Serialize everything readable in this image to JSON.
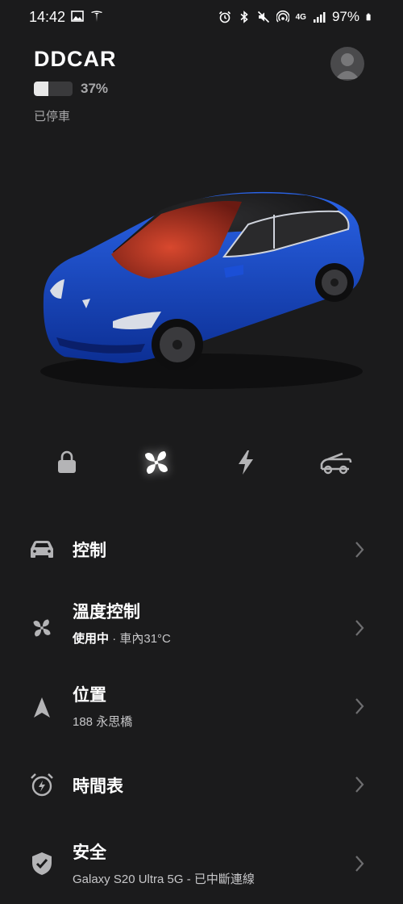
{
  "status_bar": {
    "time": "14:42",
    "battery_percent": "97%",
    "network": "4G",
    "icons": [
      "image-icon",
      "tesla-logo-icon",
      "alarm-icon",
      "bluetooth-icon",
      "mute-icon",
      "hotspot-icon",
      "signal-icon",
      "battery-icon"
    ]
  },
  "vehicle": {
    "name": "DDCAR",
    "battery_level": 0.37,
    "battery_label": "37%",
    "state": "已停車",
    "paint_color": "#1446c8",
    "cabin_glow_color": "#c6402c"
  },
  "quick_actions": [
    {
      "name": "lock",
      "icon": "lock-icon"
    },
    {
      "name": "climate",
      "icon": "fan-icon"
    },
    {
      "name": "charge",
      "icon": "bolt-icon"
    },
    {
      "name": "frunk",
      "icon": "frunk-icon"
    }
  ],
  "menu": {
    "controls": {
      "title": "控制",
      "icon": "car-icon"
    },
    "climate": {
      "title": "溫度控制",
      "status": "使用中",
      "separator": "·",
      "detail": "車內31°C",
      "icon": "fan-icon"
    },
    "location": {
      "title": "位置",
      "subtitle": "188 永思橋",
      "icon": "navigation-arrow-icon"
    },
    "schedule": {
      "title": "時間表",
      "icon": "alarm-clock-icon"
    },
    "security": {
      "title": "安全",
      "subtitle": "Galaxy S20 Ultra 5G - 已中斷連線",
      "icon": "shield-check-icon"
    }
  },
  "colors": {
    "background": "#1b1b1c",
    "text_primary": "#ffffff",
    "text_secondary": "#a8a8aa",
    "icon_inactive": "#b4b4b6"
  }
}
